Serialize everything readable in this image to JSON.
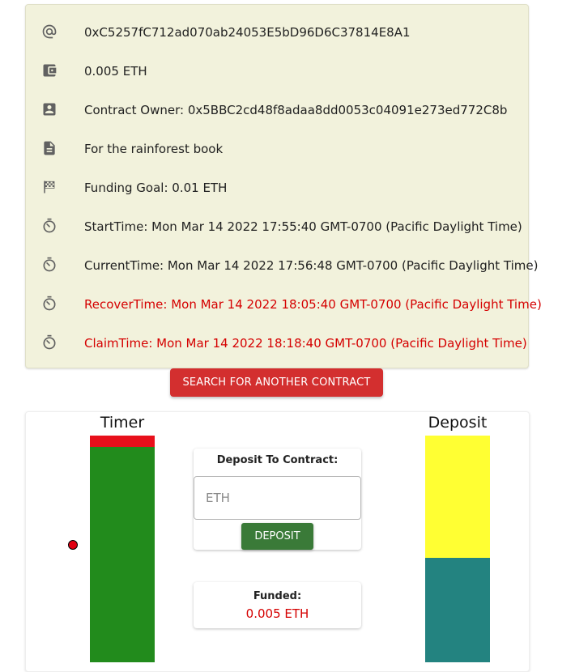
{
  "contract": {
    "rows": [
      {
        "icon": "at-icon",
        "text": "0xC5257fC712ad070ab24053E5bD96D6C37814E8A1",
        "color": "#212121"
      },
      {
        "icon": "wallet-icon",
        "text": "0.005 ETH",
        "color": "#212121"
      },
      {
        "icon": "account-box-icon",
        "text": "Contract Owner: 0x5BBC2cd48f8adaa8dd0053c04091e273ed772C8b",
        "color": "#212121"
      },
      {
        "icon": "description-icon",
        "text": "For the rainforest book",
        "color": "#212121"
      },
      {
        "icon": "checkered-flag-icon",
        "text": "Funding Goal: 0.01 ETH",
        "color": "#212121"
      },
      {
        "icon": "timer-icon",
        "text": "StartTime: Mon Mar 14 2022 17:55:40 GMT-0700 (Pacific Daylight Time)",
        "color": "#212121"
      },
      {
        "icon": "timer-icon",
        "text": "CurrentTime: Mon Mar 14 2022 17:56:48 GMT-0700 (Pacific Daylight Time)",
        "color": "#212121"
      },
      {
        "icon": "timer-icon",
        "text": "RecoverTime: Mon Mar 14 2022 18:05:40 GMT-0700 (Pacific Daylight Time)",
        "color": "#d50000"
      },
      {
        "icon": "timer-icon",
        "text": "ClaimTime: Mon Mar 14 2022 18:18:40 GMT-0700 (Pacific Daylight Time)",
        "color": "#d50000"
      }
    ]
  },
  "search_button_label": "SEARCH FOR ANOTHER CONTRACT",
  "timer": {
    "title": "Timer",
    "elapsed_fraction_red": 0.05,
    "colors": {
      "remaining": "#228b1c",
      "elapsed": "#e8101b",
      "marker": "#e00012"
    }
  },
  "deposit_form": {
    "title": "Deposit To Contract:",
    "input_placeholder": "ETH",
    "input_value": "",
    "button_label": "DEPOSIT",
    "button_color": "#3a7a38"
  },
  "funded": {
    "label": "Funded:",
    "value": "0.005 ETH",
    "color": "#d50000"
  },
  "deposit_gauge": {
    "title": "Deposit",
    "funded_fraction": 0.46,
    "colors": {
      "funded": "#238380",
      "remaining": "#ffff33"
    }
  }
}
